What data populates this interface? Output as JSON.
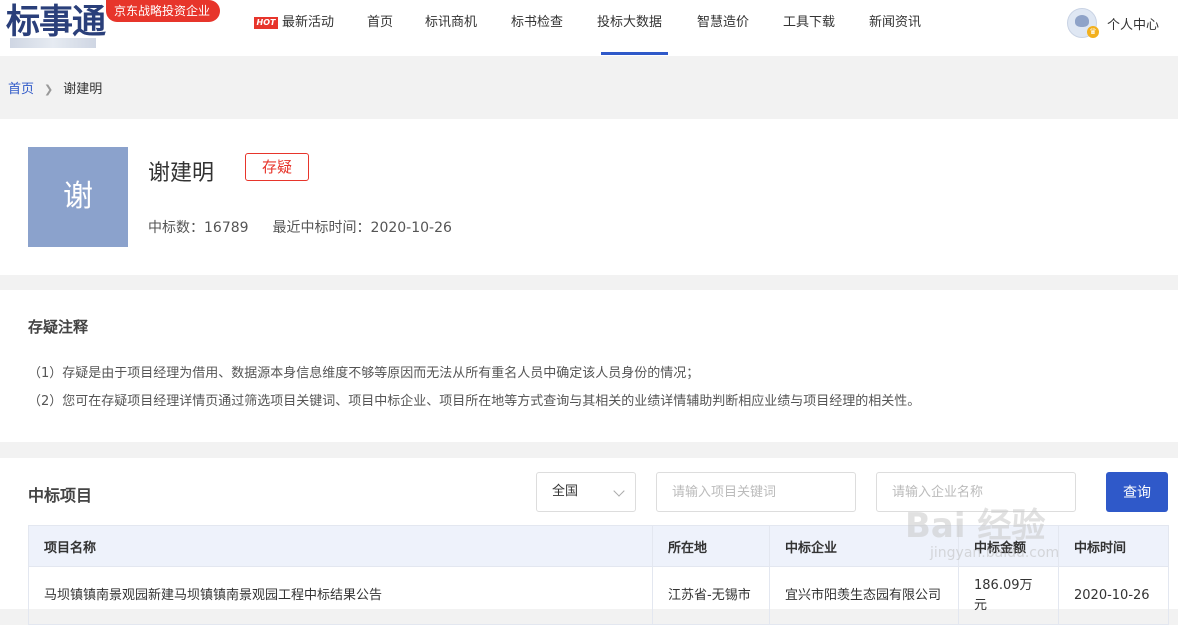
{
  "header": {
    "logo_text": "标事通",
    "promo_badge": "京东战略投资企业",
    "nav": [
      {
        "label": "最新活动",
        "hot": "HOT"
      },
      {
        "label": "首页"
      },
      {
        "label": "标讯商机"
      },
      {
        "label": "标书检查"
      },
      {
        "label": "投标大数据",
        "active": true
      },
      {
        "label": "智慧造价"
      },
      {
        "label": "工具下载"
      },
      {
        "label": "新闻资讯"
      }
    ],
    "user_label": "个人中心"
  },
  "breadcrumb": {
    "home": "首页",
    "current": "谢建明"
  },
  "profile": {
    "avatar_char": "谢",
    "name": "谢建明",
    "tag": "存疑",
    "win_count_label": "中标数：16789",
    "latest_win_label": "最近中标时间：2020-10-26"
  },
  "notes": {
    "title": "存疑注释",
    "lines": [
      "（1）存疑是由于项目经理为借用、数据源本身信息维度不够等原因而无法从所有重名人员中确定该人员身份的情况；",
      "（2）您可在存疑项目经理详情页通过筛选项目关键词、项目中标企业、项目所在地等方式查询与其相关的业绩详情辅助判断相应业绩与项目经理的相关性。"
    ]
  },
  "projects": {
    "title": "中标项目",
    "region_value": "全国",
    "keyword_placeholder": "请输入项目关键词",
    "company_placeholder": "请输入企业名称",
    "query_label": "查询",
    "columns": [
      "项目名称",
      "所在地",
      "中标企业",
      "中标金额",
      "中标时间"
    ],
    "rows": [
      [
        "马坝镇镇南景观园新建马坝镇镇南景观园工程中标结果公告",
        "江苏省-无锡市",
        "宜兴市阳羡生态园有限公司",
        "186.09万元",
        "2020-10-26"
      ]
    ]
  },
  "watermark": {
    "main": "Bai 经验",
    "sub": "jingyan.baidu.com"
  }
}
